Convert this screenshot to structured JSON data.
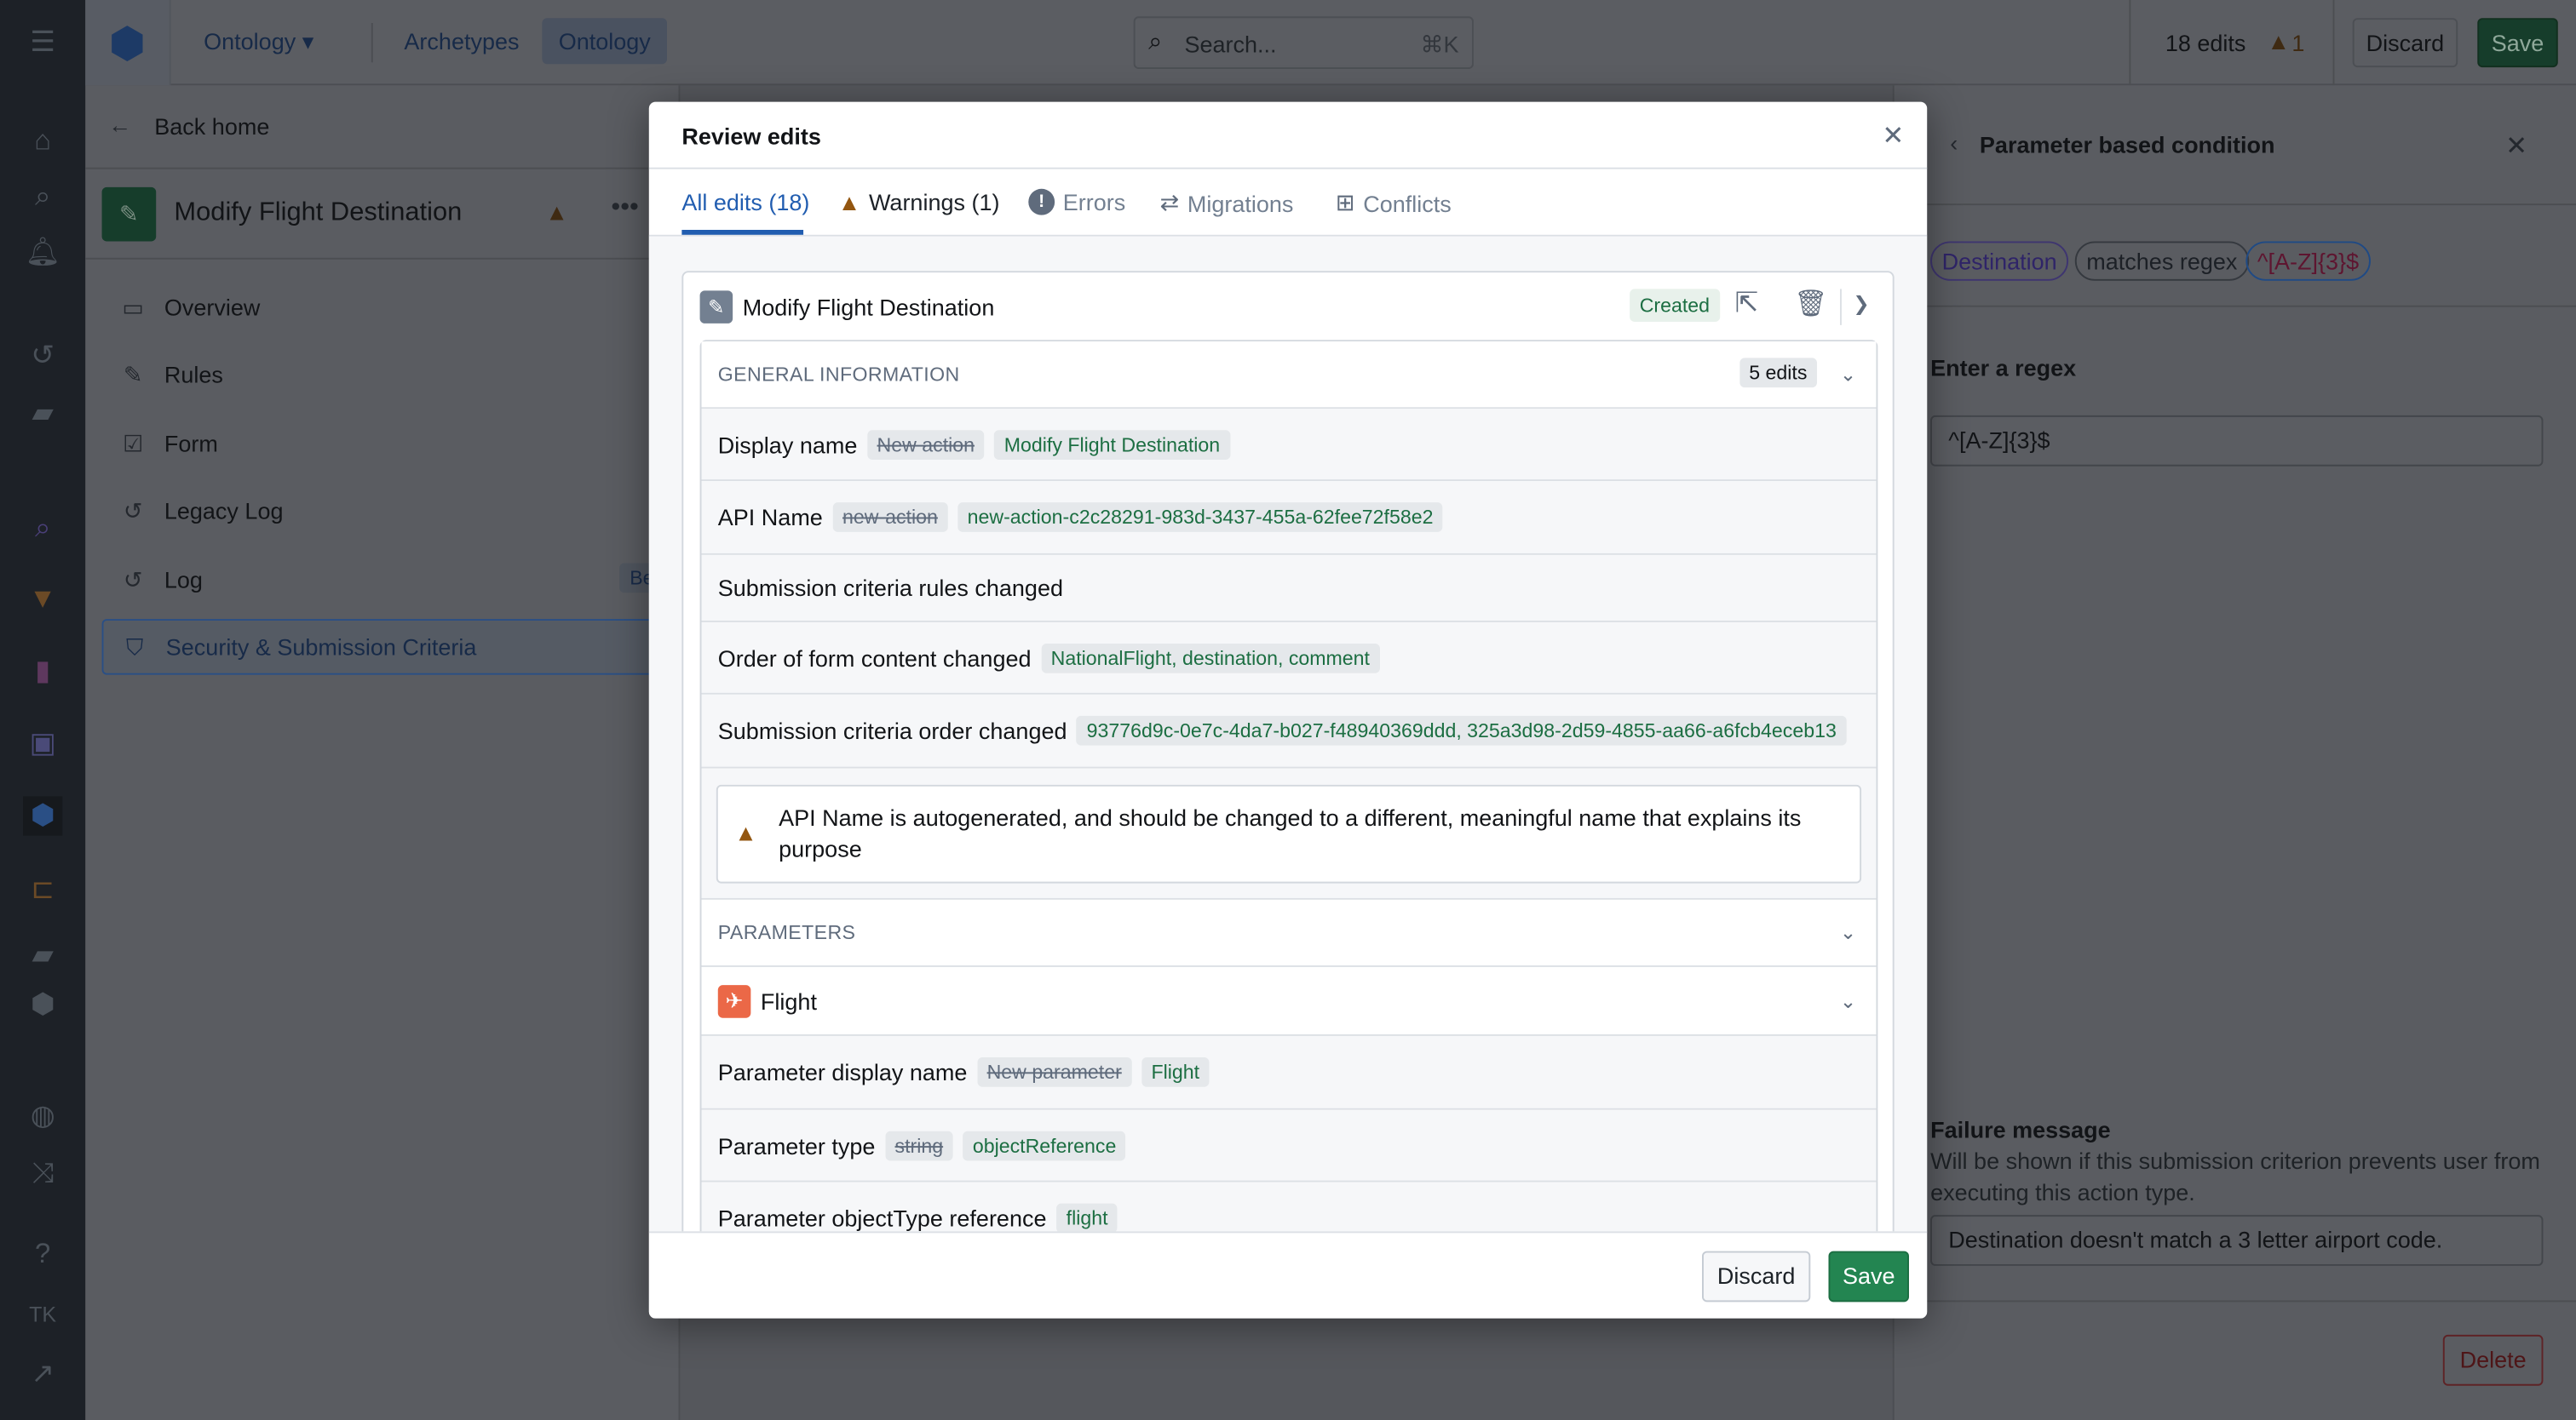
{
  "colors": {
    "accent": "#215db0",
    "success": "#238551",
    "warning": "#935610",
    "rail": "#252a31"
  },
  "topbar": {
    "app_menu": "Ontology",
    "tabs": [
      "Archetypes",
      "Ontology"
    ],
    "search_placeholder": "Search...",
    "search_shortcut": "⌘K",
    "edits": "18 edits",
    "warning_count": "1",
    "discard": "Discard",
    "save": "Save"
  },
  "left": {
    "back": "Back home",
    "title": "Modify Flight Destination",
    "nav": [
      {
        "label": "Overview",
        "icon": "monitor-icon"
      },
      {
        "label": "Rules",
        "icon": "pencil-icon"
      },
      {
        "label": "Form",
        "icon": "checklist-icon"
      },
      {
        "label": "Legacy Log",
        "icon": "history-icon"
      },
      {
        "label": "Log",
        "icon": "history-icon",
        "badge": "Beta"
      },
      {
        "label": "Security & Submission Criteria",
        "icon": "shield-icon",
        "selected": true
      }
    ]
  },
  "right": {
    "title": "Parameter based condition",
    "chips": [
      "Destination",
      "matches regex",
      "^[A-Z]{3}$"
    ],
    "regex_label": "Enter a regex",
    "regex_value": "^[A-Z]{3}$",
    "failure_label": "Failure message",
    "failure_desc": "Will be shown if this submission criterion prevents user from executing this action type.",
    "failure_value": "Destination doesn't match a 3 letter airport code.",
    "delete": "Delete"
  },
  "modal": {
    "title": "Review edits",
    "tabs": [
      {
        "label": "All edits (18)",
        "active": true
      },
      {
        "label": "Warnings (1)"
      },
      {
        "label": "Errors"
      },
      {
        "label": "Migrations"
      },
      {
        "label": "Conflicts"
      }
    ],
    "card": {
      "title": "Modify Flight Destination",
      "status": "Created"
    },
    "general": {
      "header": "GENERAL INFORMATION",
      "count": "5 edits",
      "rows": [
        {
          "label": "Display name",
          "old": "New action",
          "new": "Modify Flight Destination"
        },
        {
          "label": "API Name",
          "old": "new-action",
          "new": "new-action-c2c28291-983d-3437-455a-62fee72f58e2"
        },
        {
          "label": "Submission criteria rules changed"
        },
        {
          "label": "Order of form content changed",
          "new": "NationalFlight, destination, comment"
        },
        {
          "label": "Submission criteria order changed",
          "new": "93776d9c-0e7c-4da7-b027-f48940369ddd, 325a3d98-2d59-4855-aa66-a6fcb4eceb13"
        }
      ],
      "warning": "API Name is autogenerated, and should be changed to a different, meaningful name that explains its purpose"
    },
    "parameters": {
      "header": "PARAMETERS",
      "param": "Flight",
      "rows": [
        {
          "label": "Parameter display name",
          "old": "New parameter",
          "new": "Flight"
        },
        {
          "label": "Parameter type",
          "old": "string",
          "new": "objectReference"
        },
        {
          "label": "Parameter objectType reference",
          "new": "flight"
        }
      ]
    },
    "discard": "Discard",
    "save": "Save"
  }
}
